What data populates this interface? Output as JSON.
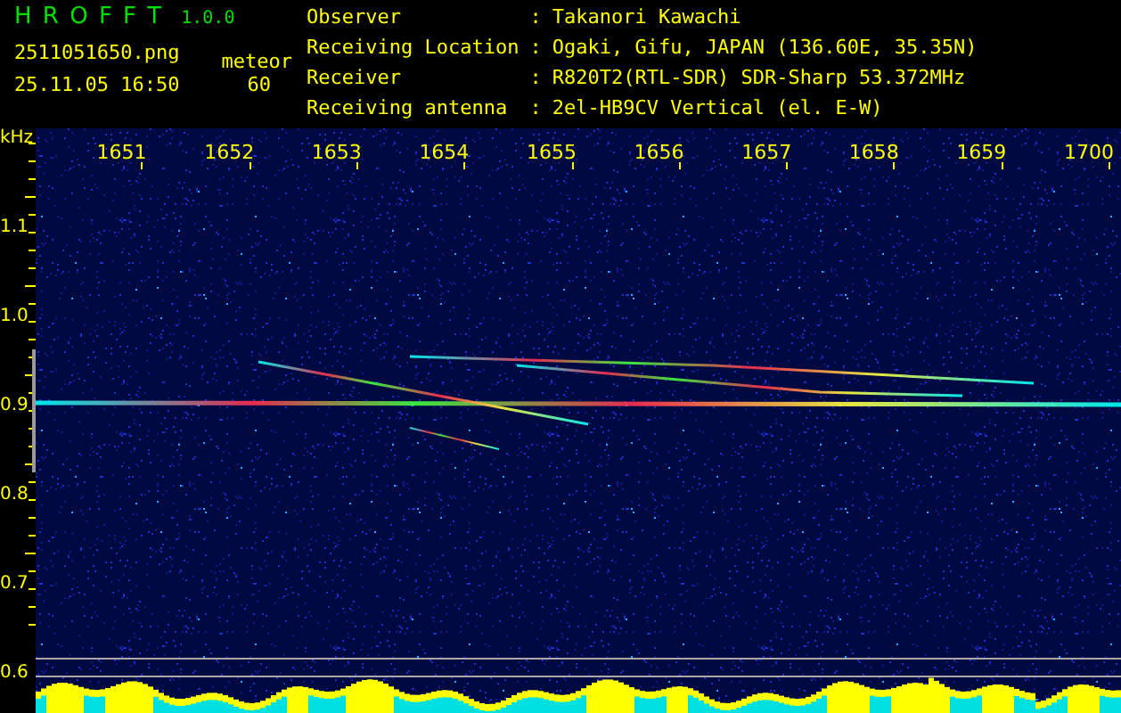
{
  "app": {
    "name": "H R O F F T",
    "version": "1.0.0",
    "file": "2511051650.png",
    "timestamp": "25.11.05 16:50",
    "mode_label": "meteor",
    "mode_value": "60"
  },
  "info": [
    {
      "label": "Observer",
      "separator": ":",
      "value": "Takanori Kawachi"
    },
    {
      "label": "Receiving Location",
      "separator": ":",
      "value": "Ogaki, Gifu, JAPAN (136.60E, 35.35N)"
    },
    {
      "label": "Receiver",
      "separator": ":",
      "value": "R820T2(RTL-SDR) SDR-Sharp 53.372MHz"
    },
    {
      "label": "Receiving antenna",
      "separator": ":",
      "value": "2el-HB9CV Vertical (el. E-W)"
    }
  ],
  "spectrogram": {
    "unit": "kHz",
    "time_ticks": [
      "1651",
      "1652",
      "1653",
      "1654",
      "1655",
      "1656",
      "1657",
      "1658",
      "1659",
      "1700"
    ],
    "freq_ticks": [
      "1.1",
      "1.0",
      "0.9",
      "0.8",
      "0.7",
      "0.6"
    ]
  }
}
